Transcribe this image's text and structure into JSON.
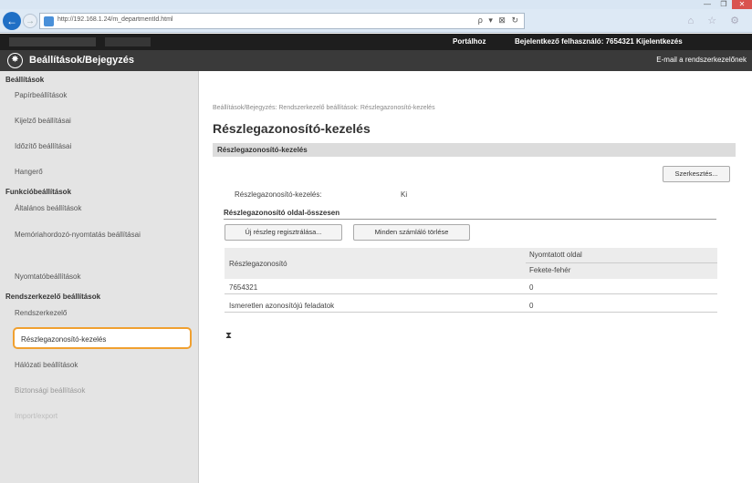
{
  "browser": {
    "url": "http://192.168.1.24/m_departmentId.html",
    "address_controls": "ρ ▾ ⊠ ↻",
    "icons": "⌂ ☆ ⚙",
    "window_controls": [
      "—",
      "❐",
      "✕"
    ]
  },
  "topbar": {
    "portal": "Portálhoz",
    "user_info": "Bejelentkező felhasználó:  7654321  Kijelentkezés"
  },
  "header": {
    "title": "Beállítások/Bejegyzés",
    "email_link": "E-mail a rendszerkezelőnek"
  },
  "sidebar": {
    "group1": "Beállítások",
    "items1": [
      "Papírbeállítások",
      "Kijelző beállításai",
      "Időzítő beállításai",
      "Hangerő"
    ],
    "group2": "Funkcióbeállítások",
    "items2": [
      "Általános beállítások",
      "Memóriahordozó-nyomtatás beállításai",
      "Nyomtatóbeállítások"
    ],
    "group3": "Rendszerkezelő beállítások",
    "items3": [
      "Rendszerkezelő",
      "Részlegazonosító-kezelés",
      "Hálózati beállítások",
      "Biztonsági beállítások",
      "Import/export"
    ]
  },
  "main": {
    "breadcrumb": "Beállítások/Bejegyzés: Rendszerkezelő beállítások: Részlegazonosító-kezelés",
    "title": "Részlegazonosító-kezelés",
    "section_title": "Részlegazonosító-kezelés",
    "edit_button": "Szerkesztés...",
    "status_label": "Részlegazonosító-kezelés:",
    "status_value": "Ki",
    "subsection": "Részlegazonosító oldal-összesen",
    "register_button": "Új részleg regisztrálása...",
    "clear_button": "Minden számláló törlése",
    "table": {
      "col_id": "Részlegazonosító",
      "col_pages": "Nyomtatott oldal",
      "col_bw": "Fekete-fehér",
      "rows": [
        {
          "id": "7654321",
          "value": "0"
        },
        {
          "id": "Ismeretlen azonosítójú feladatok",
          "value": "0"
        }
      ]
    },
    "top_marker": "⧗"
  }
}
